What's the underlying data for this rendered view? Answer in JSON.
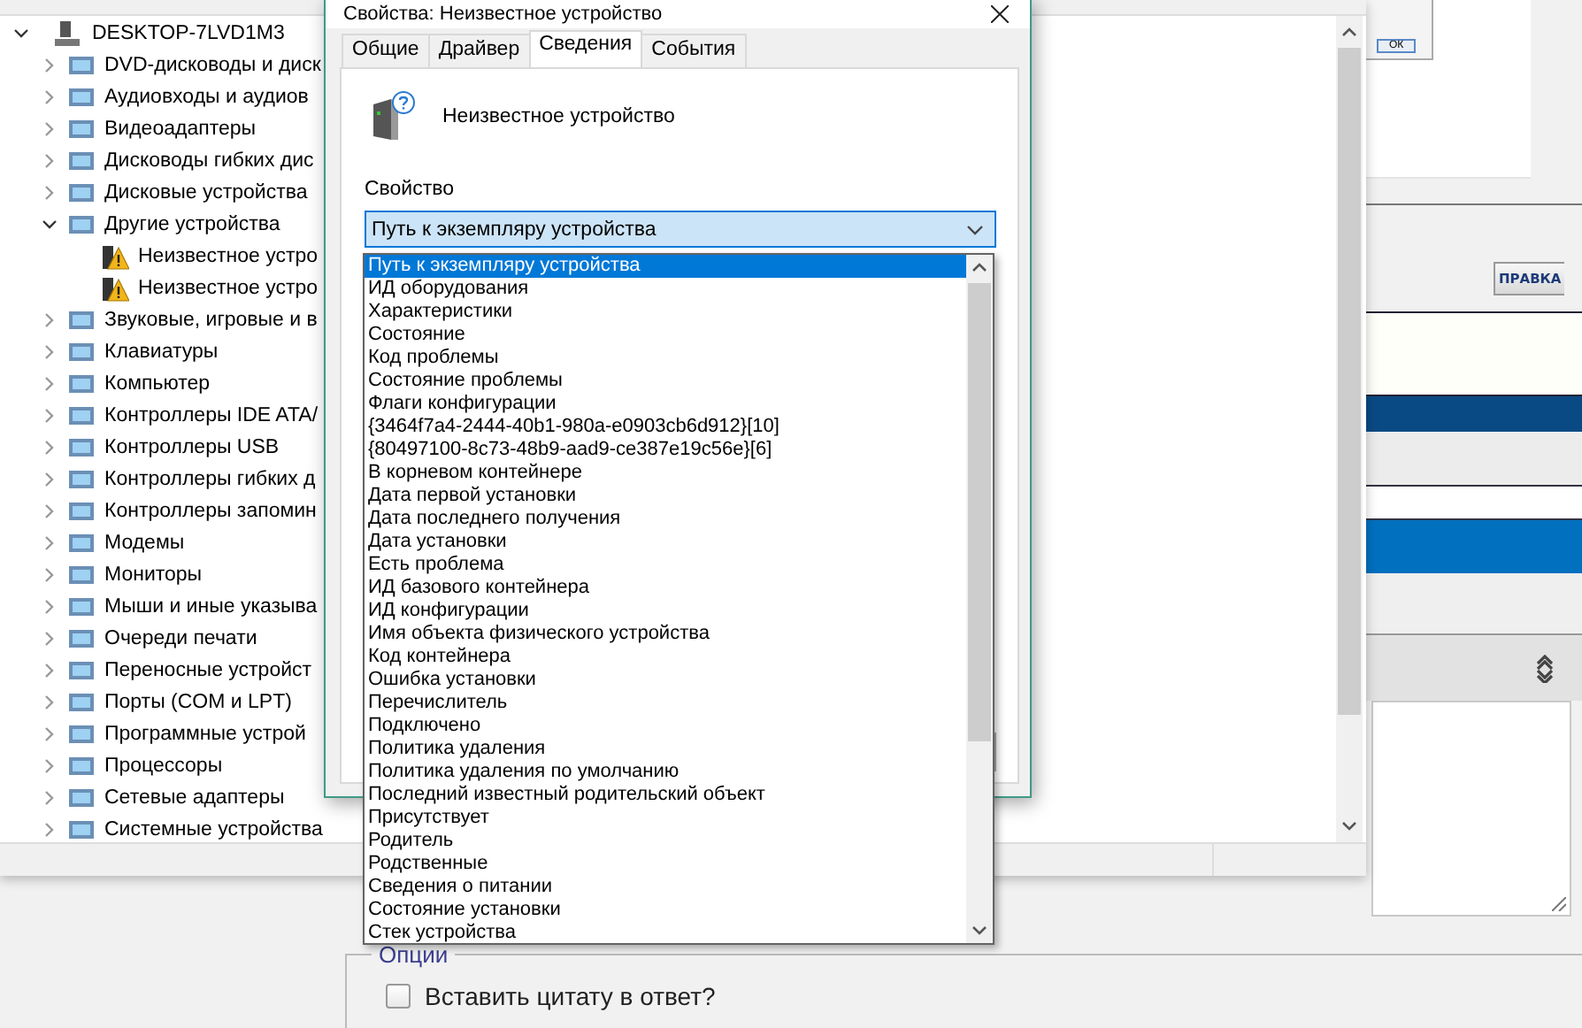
{
  "device_manager": {
    "tree": {
      "label": "DESKTOP-7LVD1M3",
      "expanded": true,
      "children": [
        {
          "label": "DVD-дисководы и диск",
          "expanded": false
        },
        {
          "label": "Аудиовходы и аудиов",
          "expanded": false
        },
        {
          "label": "Видеоадаптеры",
          "expanded": false
        },
        {
          "label": "Дисководы гибких дис",
          "expanded": false
        },
        {
          "label": "Дисковые устройства",
          "expanded": false
        },
        {
          "label": "Другие устройства",
          "expanded": true,
          "children": [
            {
              "label": "Неизвестное устро",
              "warning": true
            },
            {
              "label": "Неизвестное устро",
              "warning": true
            }
          ]
        },
        {
          "label": "Звуковые, игровые и в",
          "expanded": false
        },
        {
          "label": "Клавиатуры",
          "expanded": false
        },
        {
          "label": "Компьютер",
          "expanded": false
        },
        {
          "label": "Контроллеры IDE ATA/",
          "expanded": false
        },
        {
          "label": "Контроллеры USB",
          "expanded": false
        },
        {
          "label": "Контроллеры гибких д",
          "expanded": false
        },
        {
          "label": "Контроллеры запомин",
          "expanded": false
        },
        {
          "label": "Модемы",
          "expanded": false
        },
        {
          "label": "Мониторы",
          "expanded": false
        },
        {
          "label": "Мыши и иные указыва",
          "expanded": false
        },
        {
          "label": "Очереди печати",
          "expanded": false
        },
        {
          "label": "Переносные устройст",
          "expanded": false
        },
        {
          "label": "Порты (COM и LPT)",
          "expanded": false
        },
        {
          "label": "Программные устрой",
          "expanded": false
        },
        {
          "label": "Процессоры",
          "expanded": false
        },
        {
          "label": "Сетевые адаптеры",
          "expanded": false
        },
        {
          "label": "Системные устройства",
          "expanded": false
        }
      ]
    }
  },
  "properties_dialog": {
    "title": "Свойства: Неизвестное устройство",
    "tabs": [
      {
        "label": "Общие",
        "selected": false
      },
      {
        "label": "Драйвер",
        "selected": false
      },
      {
        "label": "Сведения",
        "selected": true
      },
      {
        "label": "События",
        "selected": false
      }
    ],
    "device_name": "Неизвестное устройство",
    "property_label": "Свойство",
    "property_select": {
      "value": "Путь к экземпляру устройства",
      "expanded": true,
      "options": [
        {
          "label": "Путь к экземпляру устройства",
          "selected": true
        },
        {
          "label": "ИД оборудования",
          "selected": false
        },
        {
          "label": "Характеристики",
          "selected": false
        },
        {
          "label": "Состояние",
          "selected": false
        },
        {
          "label": "Код проблемы",
          "selected": false
        },
        {
          "label": "Состояние проблемы",
          "selected": false
        },
        {
          "label": "Флаги конфигурации",
          "selected": false
        },
        {
          "label": "{3464f7a4-2444-40b1-980a-e0903cb6d912}[10]",
          "selected": false
        },
        {
          "label": "{80497100-8c73-48b9-aad9-ce387e19c56e}[6]",
          "selected": false
        },
        {
          "label": "В корневом контейнере",
          "selected": false
        },
        {
          "label": "Дата первой установки",
          "selected": false
        },
        {
          "label": "Дата последнего получения",
          "selected": false
        },
        {
          "label": "Дата установки",
          "selected": false
        },
        {
          "label": "Есть проблема",
          "selected": false
        },
        {
          "label": "ИД базового контейнера",
          "selected": false
        },
        {
          "label": "ИД конфигурации",
          "selected": false
        },
        {
          "label": "Имя объекта физического устройства",
          "selected": false
        },
        {
          "label": "Код контейнера",
          "selected": false
        },
        {
          "label": "Ошибка установки",
          "selected": false
        },
        {
          "label": "Перечислитель",
          "selected": false
        },
        {
          "label": "Подключено",
          "selected": false
        },
        {
          "label": "Политика удаления",
          "selected": false
        },
        {
          "label": "Политика удаления по умолчанию",
          "selected": false
        },
        {
          "label": "Последний известный родительский объект",
          "selected": false
        },
        {
          "label": "Присутствует",
          "selected": false
        },
        {
          "label": "Родитель",
          "selected": false
        },
        {
          "label": "Родственные",
          "selected": false
        },
        {
          "label": "Сведения о питании",
          "selected": false
        },
        {
          "label": "Состояние установки",
          "selected": false
        },
        {
          "label": "Стек устройства",
          "selected": false
        }
      ]
    }
  },
  "forum": {
    "dialog_button": "ОК",
    "edit_button": "ПРАВКА",
    "options": {
      "legend": "Опции",
      "quote_checkbox": {
        "label": "Вставить цитату в ответ?",
        "checked": false
      }
    }
  }
}
